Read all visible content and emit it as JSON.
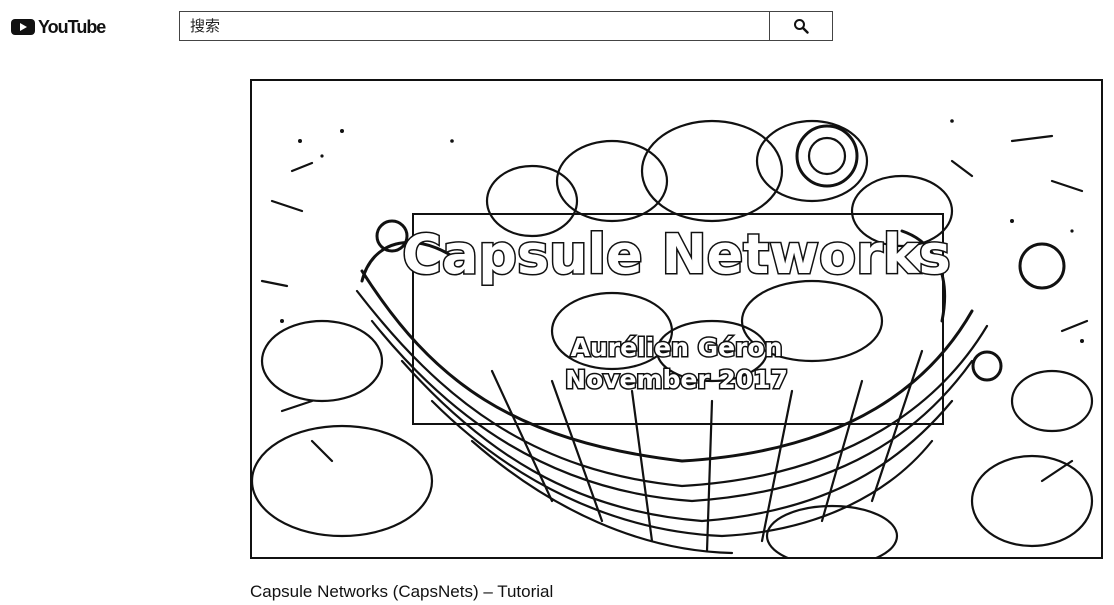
{
  "header": {
    "logo_text": "YouTube",
    "search_placeholder": "搜索"
  },
  "player": {
    "slide_title": "Capsule Networks",
    "slide_author": "Aurélien Géron",
    "slide_date": "November 2017"
  },
  "video": {
    "title": "Capsule Networks (CapsNets) – Tutorial"
  }
}
